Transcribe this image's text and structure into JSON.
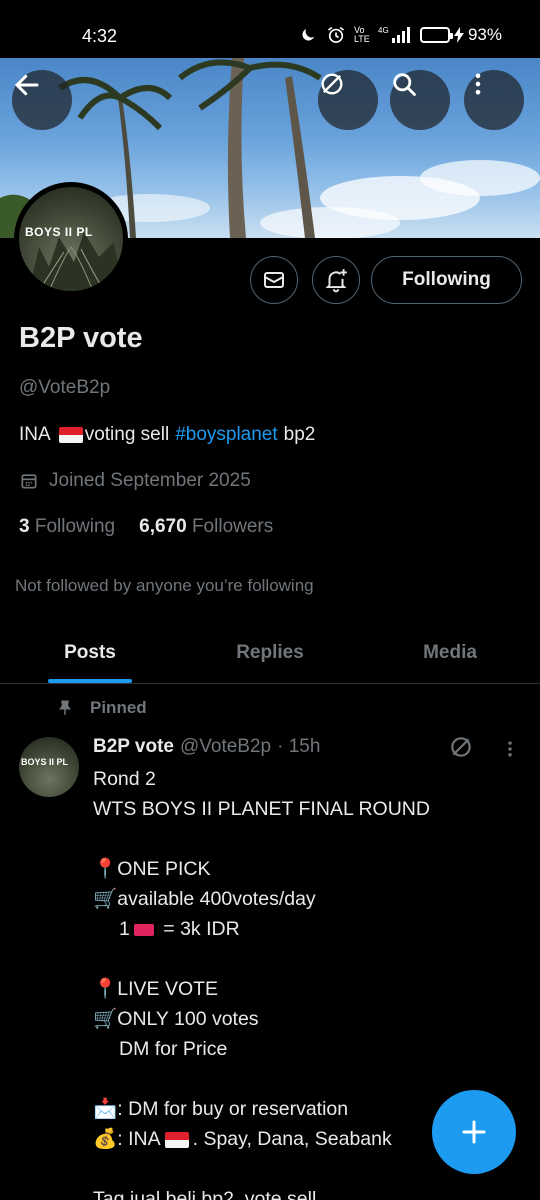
{
  "status_bar": {
    "time": "4:32",
    "network": "4G",
    "volte": "Vo LTE",
    "battery_percent": "93%",
    "battery_level": 0.93
  },
  "header": {
    "back_icon": "arrow-left-icon",
    "translate_icon": "translate-off-icon",
    "search_icon": "search-icon",
    "more_icon": "more-vertical-icon"
  },
  "avatar": {
    "text": "BOYS II PL"
  },
  "actions": {
    "following_label": "Following",
    "mail_icon": "envelope-icon",
    "notify_icon": "bell-plus-icon"
  },
  "profile": {
    "display_name": "B2P vote",
    "handle": "@VoteB2p",
    "bio_prefix": "INA",
    "bio_middle": "voting sell",
    "bio_hashtag": "#boysplanet",
    "bio_suffix": "bp2",
    "joined": "Joined September 2025",
    "following_count": "3",
    "following_label": "Following",
    "followers_count": "6,670",
    "followers_label": "Followers",
    "not_followed": "Not followed by anyone you’re following"
  },
  "tabs": [
    {
      "label": "Posts",
      "active": true
    },
    {
      "label": "Replies",
      "active": false
    },
    {
      "label": "Media",
      "active": false
    }
  ],
  "pinned_post": {
    "pinned_label": "Pinned",
    "author_name": "B2P vote",
    "author_handle": "@VoteB2p",
    "time": "· 15h",
    "avatar_text": "BOYS II PL",
    "lines": {
      "l1": "Rond 2",
      "l2": "WTS BOYS II PLANET FINAL ROUND",
      "l3": "ONE PICK",
      "l4": "available 400votes/day",
      "l5_pre": "1",
      "l5_post": " = 3k IDR",
      "l6": "LIVE VOTE",
      "l7": "ONLY 100 votes",
      "l8": "DM for Price",
      "l9": ": DM for buy or reservation",
      "l10_pre": ": INA",
      "l10_post": ". Spay, Dana, Seabank",
      "l11": "Tag jual beli bp2, vote sell"
    }
  },
  "fab": {
    "icon": "plus-icon"
  },
  "colors": {
    "accent": "#1d9bf0",
    "muted": "#71767b",
    "border": "#2f3336"
  }
}
